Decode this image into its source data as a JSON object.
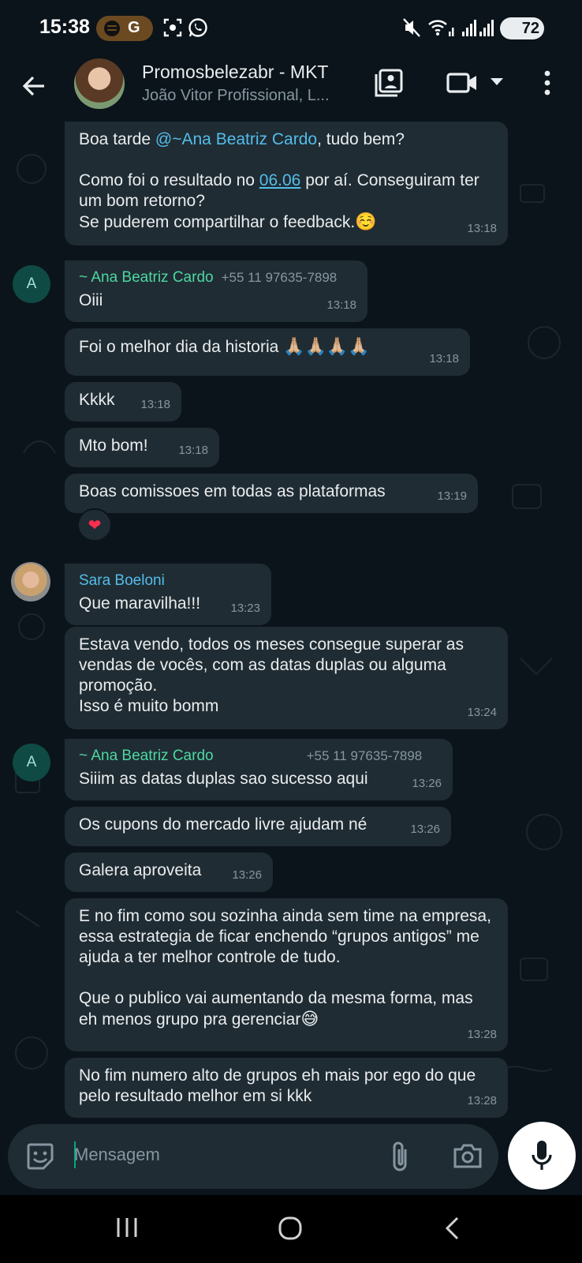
{
  "status": {
    "time": "15:38",
    "pill_label": "G",
    "battery": "72"
  },
  "header": {
    "title": "Promosbelezabr - MKT",
    "subtitle": "João Vitor Profissional, L..."
  },
  "messages": {
    "m1": {
      "greeting_pre": "Boa tarde ",
      "mention": "@~Ana Beatriz Cardo",
      "greeting_post": ", tudo bem?",
      "q_pre": "Como foi o resultado no ",
      "q_link": "06.06",
      "q_post": " por aí. Conseguiram ter um bom retorno?",
      "q_line3": "Se puderem compartilhar o feedback.",
      "emoji": "☺️",
      "time": "13:18"
    },
    "ana_avatar_letter": "A",
    "ana_name": "~ Ana Beatriz Cardo",
    "ana_phone": "+55 11 97635-7898",
    "m2": {
      "text": "Oiii",
      "time": "13:18"
    },
    "m3": {
      "text": "Foi o melhor dia da historia ",
      "emoji": "🙏🏼🙏🏼🙏🏼🙏🏼",
      "time": "13:18"
    },
    "m4": {
      "text": "Kkkk",
      "time": "13:18"
    },
    "m5": {
      "text": "Mto bom!",
      "time": "13:18"
    },
    "m6": {
      "text": "Boas comissoes em todas as plataformas",
      "time": "13:19",
      "reaction": "❤"
    },
    "sara_name": "Sara Boeloni",
    "m7": {
      "text": "Que maravilha!!!",
      "time": "13:23"
    },
    "m8": {
      "text": "Estava vendo, todos os meses consegue superar as vendas de vocês, com as datas duplas ou alguma promoção.\nIsso é muito bomm",
      "time": "13:24"
    },
    "m9": {
      "text": "Siiim as datas duplas sao sucesso aqui",
      "time": "13:26"
    },
    "m10": {
      "text": "Os cupons do mercado livre ajudam né",
      "time": "13:26"
    },
    "m11": {
      "text": "Galera aproveita",
      "time": "13:26"
    },
    "m12": {
      "p1": "E no fim como sou sozinha ainda sem time na empresa, essa estrategia de ficar enchendo “grupos antigos” me ajuda a ter melhor controle de tudo.",
      "p2": "Que o publico vai aumentando da mesma forma, mas eh menos grupo pra gerenciar",
      "emoji": "😅",
      "time": "13:28"
    },
    "m13": {
      "text": "No fim numero alto de grupos eh mais por ego do que pelo resultado melhor em si kkk",
      "time": "13:28"
    }
  },
  "composer": {
    "placeholder": "Mensagem"
  },
  "colors": {
    "background": "#0b141a",
    "bubble": "#202c33",
    "accent": "#00a884",
    "sender_green": "#4dd7a2",
    "sender_blue": "#53bdeb"
  }
}
